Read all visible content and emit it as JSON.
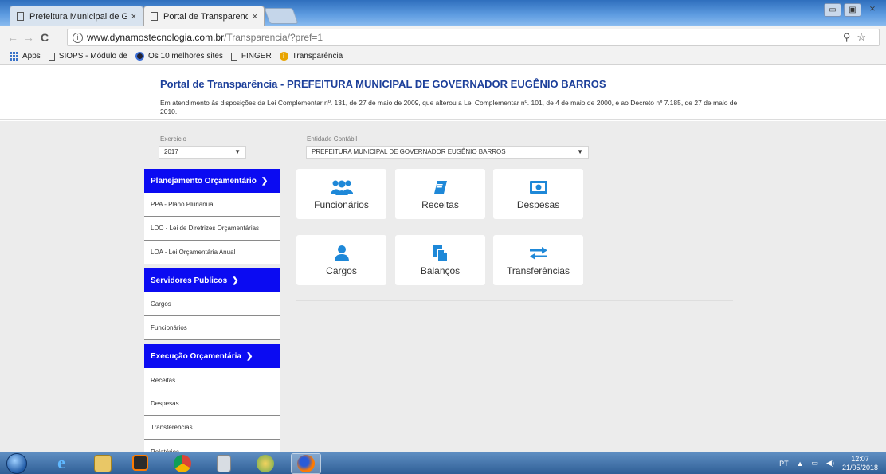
{
  "browser": {
    "tabs": [
      {
        "title": "Prefeitura Municipal de G",
        "close": "×"
      },
      {
        "title": "Portal de Transparencia",
        "close": "×"
      }
    ],
    "window_controls": {
      "minimize": "▭",
      "maximize": "▣",
      "close": "⨯"
    },
    "url_host": "www.dynamostecnologia.com.br",
    "url_path": "/Transparencia/?pref=1",
    "bookmarks": [
      {
        "label": "Apps",
        "icon": "apps-grid-icon"
      },
      {
        "label": "SIOPS - Módulo de",
        "icon": "document-icon"
      },
      {
        "label": "Os 10 melhores sites",
        "icon": "circle-icon"
      },
      {
        "label": "FINGER",
        "icon": "document-icon"
      },
      {
        "label": "Transparência",
        "icon": "info-icon"
      }
    ]
  },
  "header": {
    "title": "Portal de Transparência - PREFEITURA MUNICIPAL DE GOVERNADOR EUGÊNIO BARROS",
    "description": "Em atendimento às disposições da Lei Complementar nº. 131, de 27 de maio de 2009, que alterou a Lei Complementar nº. 101, de 4 de maio de 2000, e ao Decreto nº 7.185, de 27 de maio de 2010."
  },
  "filters": {
    "exercicio": {
      "label": "Exercício",
      "value": "2017"
    },
    "entidade": {
      "label": "Entidade Contábil",
      "value": "PREFEITURA MUNICIPAL DE GOVERNADOR EUGÊNIO BARROS"
    }
  },
  "sidebar": {
    "sections": [
      {
        "title": "Planejamento Orçamentário",
        "items": [
          "PPA - Plano Plurianual",
          "LDO - Lei de Diretrizes Orçamentárias",
          "LOA - Lei Orçamentária Anual"
        ]
      },
      {
        "title": "Servidores Publicos",
        "items": [
          "Cargos",
          "Funcionários"
        ]
      },
      {
        "title": "Execução Orçamentária",
        "items": [
          "Receitas",
          "Despesas",
          "Transferências",
          "Relatórios"
        ]
      }
    ]
  },
  "tiles": [
    {
      "label": "Funcionários",
      "icon": "users-icon"
    },
    {
      "label": "Receitas",
      "icon": "book-icon"
    },
    {
      "label": "Despesas",
      "icon": "money-icon"
    },
    {
      "label": "Cargos",
      "icon": "user-icon"
    },
    {
      "label": "Balanços",
      "icon": "documents-icon"
    },
    {
      "label": "Transferências",
      "icon": "exchange-icon"
    }
  ],
  "taskbar": {
    "language": "PT",
    "time": "12:07",
    "date": "21/05/2018"
  },
  "colors": {
    "brand_blue": "#0b0bf2",
    "title_blue": "#1c3f9a",
    "tile_icon": "#1e88d8"
  }
}
